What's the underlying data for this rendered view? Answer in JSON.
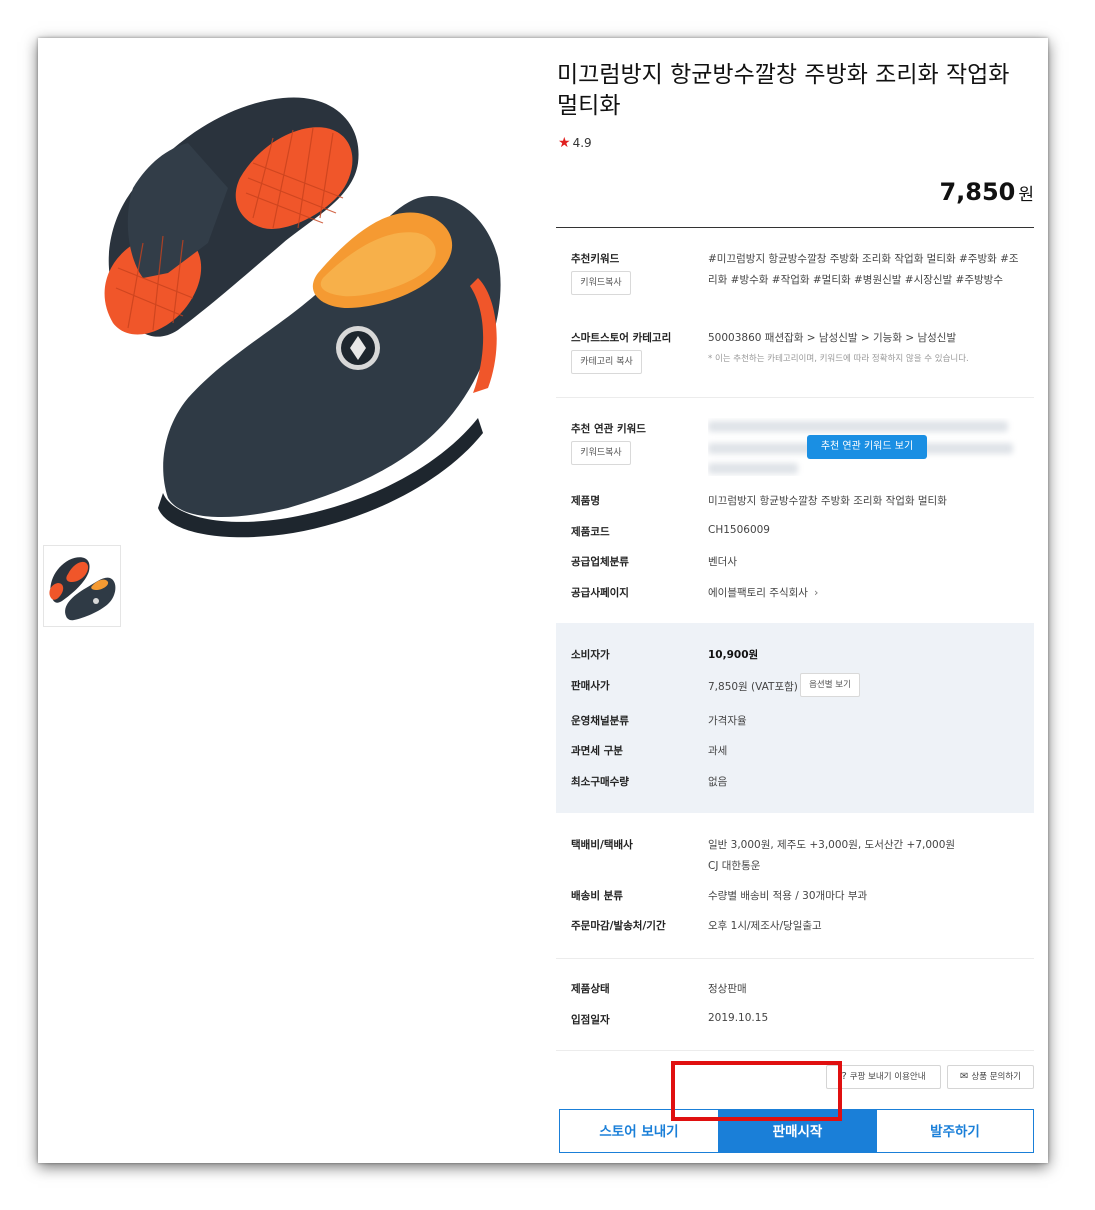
{
  "product": {
    "title": "미끄럼방지 항균방수깔창 주방화 조리화 작업화 멀티화",
    "rating": "4.9",
    "price_value": "7,850",
    "price_unit": "원"
  },
  "keywords": {
    "label": "추천키워드",
    "copy_btn": "키워드복사",
    "line1": "#미끄럼방지 항균방수깔창 주방화 조리화 작업화 멀티화 #주방화 #조",
    "line2": "리화 #방수화 #작업화 #멀티화 #병원신발 #시장신발 #주방방수"
  },
  "category": {
    "label": "스마트스토어 카테고리",
    "copy_btn": "카테고리 복사",
    "value": "50003860 패션잡화 > 남성신발 > 기능화 > 남성신발",
    "note": "* 이는 추천하는 카테고리이며, 키워드에 따라 정확하지 않을 수 있습니다."
  },
  "related": {
    "label": "추천 연관 키워드",
    "copy_btn": "키워드복사",
    "view_btn": "추천 연관 키워드 보기"
  },
  "info": {
    "name_label": "제품명",
    "name_value": "미끄럼방지 항균방수깔창 주방화 조리화 작업화 멀티화",
    "code_label": "제품코드",
    "code_value": "CH1506009",
    "supplier_type_label": "공급업체분류",
    "supplier_type_value": "벤더사",
    "supplier_page_label": "공급사페이지",
    "supplier_page_value": "에이블팩토리 주식회사"
  },
  "pricing": {
    "consumer_label": "소비자가",
    "consumer_value": "10,900원",
    "sale_label": "판매사가",
    "sale_value": "7,850원 (VAT포함)",
    "option_btn": "옵션별 보기",
    "channel_label": "운영채널분류",
    "channel_value": "가격자율",
    "tax_label": "과면세 구분",
    "tax_value": "과세",
    "min_label": "최소구매수량",
    "min_value": "없음"
  },
  "shipping": {
    "fee_label": "택배비/택배사",
    "fee_value": "일반 3,000원, 제주도 +3,000원, 도서산간 +7,000원",
    "carrier": "CJ 대한통운",
    "type_label": "배송비 분류",
    "type_value": "수량별 배송비 적용 / 30개마다 부과",
    "deadline_label": "주문마감/발송처/기간",
    "deadline_value": "오후 1시/제조사/당일출고"
  },
  "status": {
    "status_label": "제품상태",
    "status_value": "정상판매",
    "date_label": "입점일자",
    "date_value": "2019.10.15"
  },
  "aux_buttons": {
    "coupang": "쿠팡 보내기 이용안내",
    "inquiry": "상품 문의하기"
  },
  "actions": {
    "store": "스토어 보내기",
    "sale": "판매시작",
    "order": "발주하기"
  },
  "colors": {
    "accent": "#1a7fd8",
    "highlight": "#e01010",
    "shoe_body": "#2f3a45",
    "sole": "#f0562a"
  }
}
